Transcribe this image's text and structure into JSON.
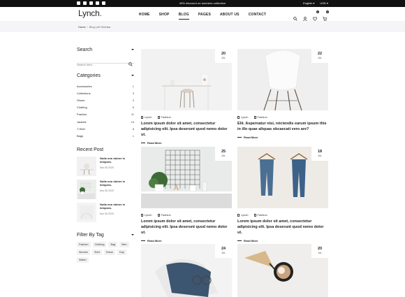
{
  "topbar": {
    "promo": "40% discount on womens collection",
    "language": "English",
    "currency": "USD"
  },
  "header": {
    "logo": "Lynch",
    "nav": [
      "HOME",
      "SHOP",
      "BLOG",
      "PAGES",
      "ABOUT US",
      "CONTACT"
    ],
    "active_nav": "BLOG",
    "wishlist_count": "0",
    "cart_count": "0"
  },
  "breadcrumb": {
    "home": "Home",
    "separator": "/",
    "current": "Blog Left Sidebar"
  },
  "sidebar": {
    "search": {
      "title": "Search",
      "placeholder": "Search here..."
    },
    "categories": {
      "title": "Categories",
      "items": [
        {
          "label": "Accessories",
          "count": "1"
        },
        {
          "label": "Collections",
          "count": "3"
        },
        {
          "label": "Shoes",
          "count": "3"
        },
        {
          "label": "Clothing",
          "count": "6"
        },
        {
          "label": "Fashion",
          "count": "11"
        },
        {
          "label": "Jackets",
          "count": "15"
        },
        {
          "label": "T-Shirt",
          "count": "8"
        },
        {
          "label": "Bags",
          "count": "1"
        }
      ]
    },
    "recent": {
      "title": "Recent Post",
      "items": [
        {
          "title": "Nulla non dolore is tempora.",
          "date": "Nov 06 2020"
        },
        {
          "title": "Nulla non dolore is tempora.",
          "date": "Nov 06 2020"
        },
        {
          "title": "Nulla non dolore is tempora.",
          "date": "Nov 06 2020"
        }
      ]
    },
    "tags": {
      "title": "Filter By Tag",
      "items": [
        "Fashion",
        "Clothing",
        "Bag",
        "Men",
        "Women",
        "Shirt",
        "Dress",
        "Cap",
        "Watch"
      ]
    }
  },
  "posts": [
    {
      "day": "20",
      "month": "JUL",
      "author": "Lynch",
      "category": "Fashion",
      "title": "Lorem ipsum dolor sit amet, consectetur adipisicing elit. Ipsa deserunt quod nemo dolor ut.",
      "read_more": "Read More"
    },
    {
      "day": "22",
      "month": "JUL",
      "author": "Lynch",
      "category": "Fashion",
      "title": "Elit. Aspernatur nisi, reiciendis earum ipsum this in illo quae aliquas obcaecati vero are?",
      "read_more": "Read More"
    },
    {
      "day": "25",
      "month": "JUL",
      "author": "Lynch",
      "category": "Fashion",
      "title": "Lorem ipsum dolor sit amet, consectetur adipisicing elit. Ipsa deserunt quod nemo dolor ut.",
      "read_more": "Read More"
    },
    {
      "day": "18",
      "month": "JUL",
      "author": "Lynch",
      "category": "Fashion",
      "title": "Lorem ipsum dolor sit amet, consectetur adipisicing elit. Ipsa deserunt quod nemo dolor ut.",
      "read_more": "Read More"
    },
    {
      "day": "24",
      "month": "JUL"
    },
    {
      "day": "20",
      "month": "JUL"
    }
  ]
}
